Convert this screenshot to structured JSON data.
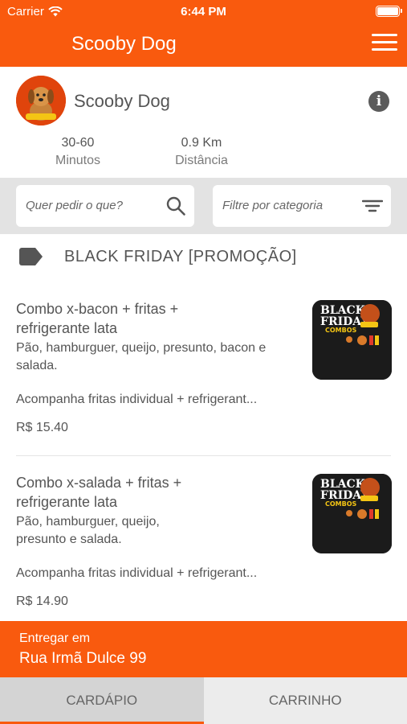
{
  "status_bar": {
    "carrier": "Carrier",
    "time": "6:44 PM"
  },
  "nav": {
    "title": "Scooby Dog",
    "menu_icon": "hamburger-menu-icon"
  },
  "store": {
    "name": "Scooby Dog",
    "delivery_time": {
      "value": "30-60",
      "label": "Minutos"
    },
    "distance": {
      "value": "0.9 Km",
      "label": "Distância"
    }
  },
  "search": {
    "placeholder": "Quer pedir o que?"
  },
  "category_filter": {
    "placeholder": "Filtre por categoria"
  },
  "section": {
    "title": "BLACK FRIDAY [PROMOÇÃO]"
  },
  "products": [
    {
      "name": "Combo x-bacon + fritas + refrigerante lata",
      "description": "Pão, hamburguer, queijo, presunto, bacon e salada.",
      "extra": "Acompanha fritas individual + refrigerant...",
      "price": "R$ 15.40"
    },
    {
      "name": "Combo x-salada + fritas + refrigerante lata",
      "description": "Pão, hamburguer, queijo, presunto e salada.",
      "extra": "Acompanha fritas individual + refrigerant...",
      "price": "R$ 14.90"
    }
  ],
  "thumbnail": {
    "line1": "BLACK",
    "line2": "FRIDAY",
    "line3": "COMBOS"
  },
  "delivery": {
    "label": "Entregar em",
    "address": "Rua Irmã Dulce 99"
  },
  "tabs": [
    {
      "label": "CARDÁPIO",
      "active": true
    },
    {
      "label": "CARRINHO",
      "active": false
    }
  ],
  "colors": {
    "brand": "#f95a0e",
    "filter_bg": "#e3e3e3",
    "text": "#555555"
  }
}
